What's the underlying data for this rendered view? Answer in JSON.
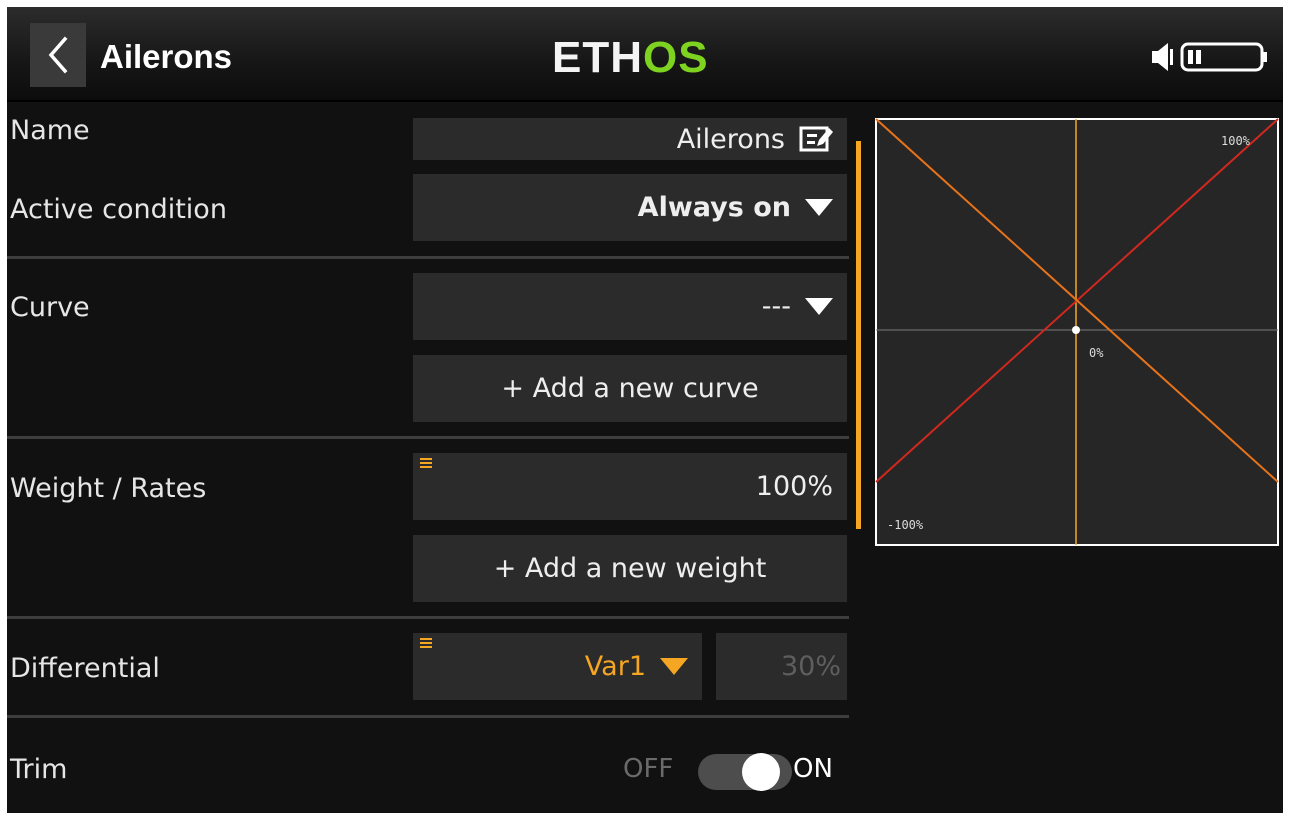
{
  "header": {
    "title": "Ailerons",
    "logo_main": "ETH",
    "logo_accent": "OS",
    "back_icon": "chevron-left-icon",
    "speaker_icon": "speaker-icon",
    "battery_icon": "battery-icon",
    "accent_color": "#7ed321"
  },
  "form": {
    "name": {
      "label": "Name",
      "value": "Ailerons",
      "icon": "edit-icon"
    },
    "active_condition": {
      "label": "Active condition",
      "value": "Always on"
    },
    "curve": {
      "label": "Curve",
      "value": "---",
      "add_button": "+ Add a new curve"
    },
    "weight": {
      "label": "Weight / Rates",
      "value": "100%",
      "add_button": "+ Add a new weight"
    },
    "differential": {
      "label": "Differential",
      "source": "Var1",
      "value": "30%"
    },
    "trim": {
      "label": "Trim",
      "off_label": "OFF",
      "on_label": "ON",
      "state": "on"
    }
  },
  "graph": {
    "top_label": "100%",
    "center_label": "0%",
    "bottom_label": "-100%",
    "line_colors": {
      "red": "#d0281e",
      "orange": "#e8731a",
      "axis": "#f5a623"
    }
  },
  "colors": {
    "highlight": "#f5a623",
    "field_bg": "#2b2b2b",
    "screen_bg": "#111111"
  }
}
